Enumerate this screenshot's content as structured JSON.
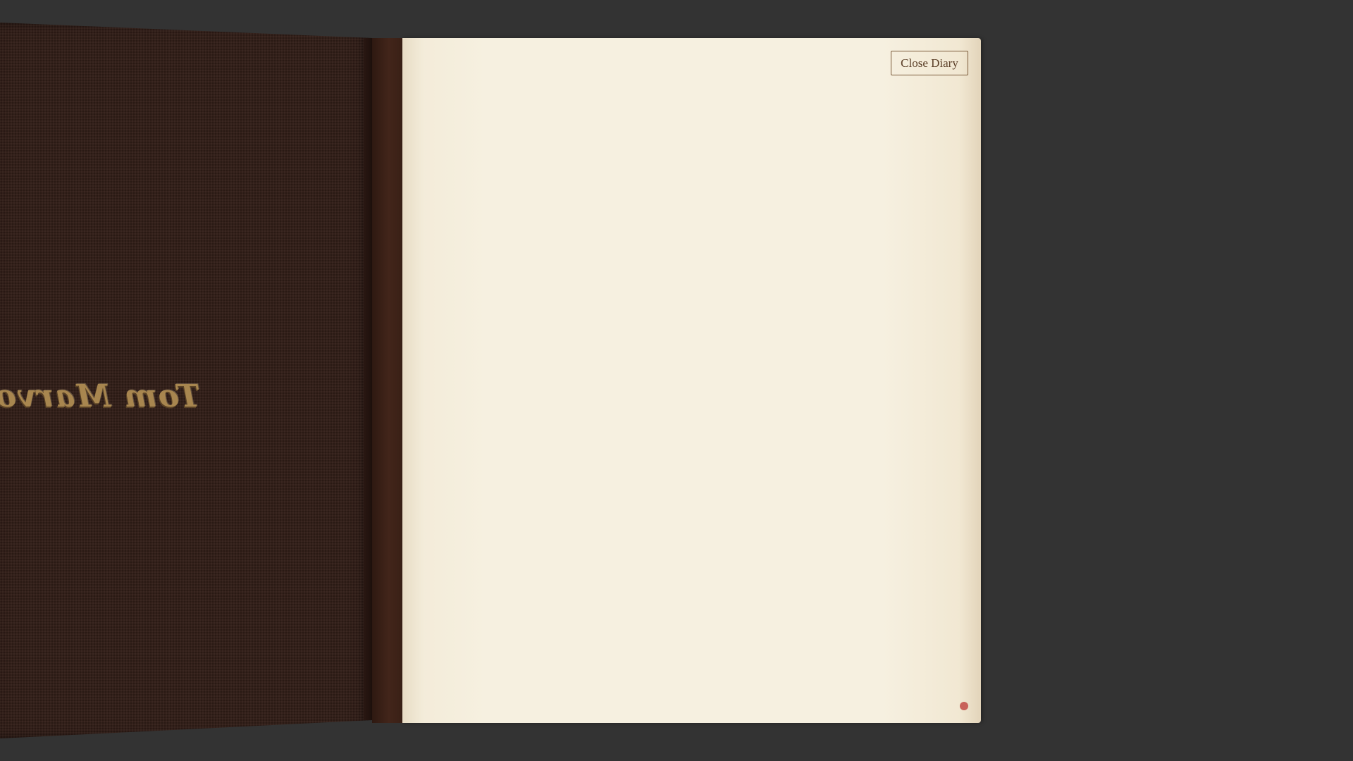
{
  "diary": {
    "cover_inscription": "Tom Marvolo",
    "close_label": "Close Diary"
  },
  "colors": {
    "background": "#333333",
    "cover": "#33201a",
    "spine": "#42251a",
    "page": "#f6f0e0",
    "inscription_gold": "#a8864f",
    "marker_dot": "#c8625a"
  },
  "icons": {
    "page_marker": "dot-icon"
  }
}
